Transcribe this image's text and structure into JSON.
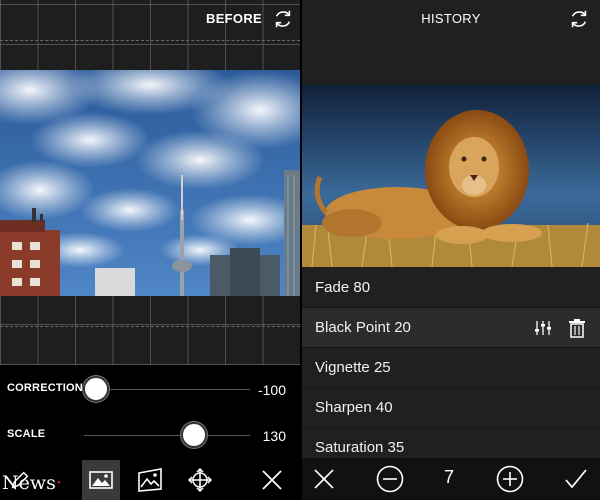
{
  "left_panel": {
    "before_label": "BEFORE",
    "sliders": [
      {
        "label": "CORRECTION",
        "value": "-100",
        "level": 0.07
      },
      {
        "label": "SCALE",
        "value": "130",
        "level": 0.66
      }
    ],
    "toolbar": {
      "icons": [
        "pencil-icon",
        "photo-icon",
        "landscape-icon",
        "move-icon",
        "close-icon"
      ],
      "active": "photo-icon"
    },
    "watermark": "News"
  },
  "right_panel": {
    "title": "HISTORY",
    "history": [
      {
        "label": "Fade 80"
      },
      {
        "label": "Black Point 20",
        "selected": true
      },
      {
        "label": "Vignette 25"
      },
      {
        "label": "Sharpen 40"
      },
      {
        "label": "Saturation 35"
      }
    ],
    "toolbar": {
      "step_count": "7"
    }
  },
  "colors": {
    "panel_bg": "#1b1b1b",
    "selected_row": "#2c2c2c",
    "accent": "#ffffff"
  }
}
